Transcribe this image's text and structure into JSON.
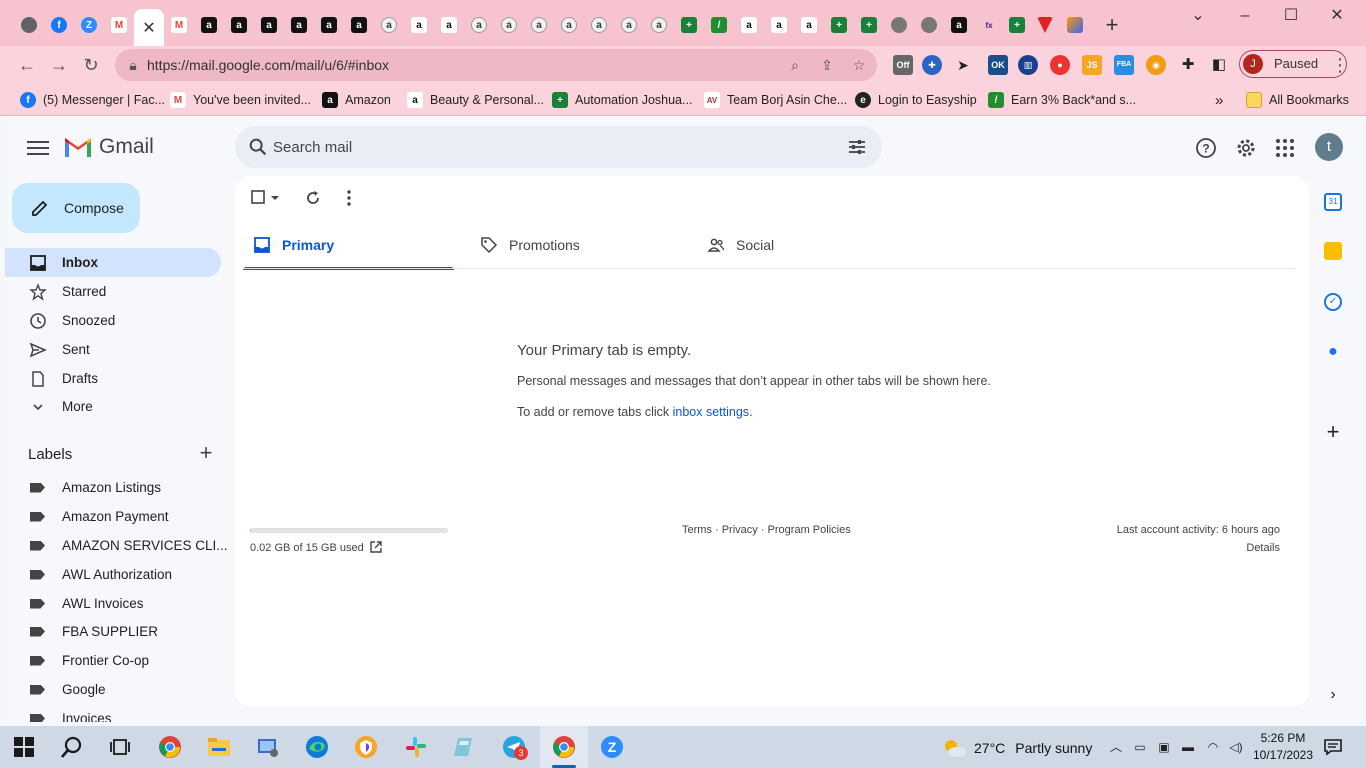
{
  "browser": {
    "url": "https://mail.google.com/mail/u/6/#inbox",
    "profile_initial": "J",
    "profile_status": "Paused",
    "bookmarks": [
      {
        "label": "(5) Messenger | Fac...",
        "icon": "facebook-icon"
      },
      {
        "label": "You've been invited...",
        "icon": "gmail-icon"
      },
      {
        "label": "Amazon",
        "icon": "amazon-icon"
      },
      {
        "label": "Beauty & Personal...",
        "icon": "amazon-smile-icon"
      },
      {
        "label": "Automation Joshua...",
        "icon": "sheets-icon"
      },
      {
        "label": "Team Borj Asin Che...",
        "icon": "team-icon"
      },
      {
        "label": "Login to Easyship",
        "icon": "easyship-icon"
      },
      {
        "label": "Earn 3% Back*and s...",
        "icon": "cashback-icon"
      }
    ],
    "all_bookmarks": "All Bookmarks",
    "overflow": "»"
  },
  "gmail": {
    "brand": "Gmail",
    "search_placeholder": "Search mail",
    "account_initial": "t",
    "compose_label": "Compose",
    "nav": [
      {
        "label": "Inbox",
        "icon": "inbox-icon",
        "active": true
      },
      {
        "label": "Starred",
        "icon": "star-icon"
      },
      {
        "label": "Snoozed",
        "icon": "clock-icon"
      },
      {
        "label": "Sent",
        "icon": "send-icon"
      },
      {
        "label": "Drafts",
        "icon": "draft-icon"
      },
      {
        "label": "More",
        "icon": "chevron-down-icon"
      }
    ],
    "labels_title": "Labels",
    "labels": [
      "Amazon Listings",
      "Amazon Payment",
      "AMAZON SERVICES CLI...",
      "AWL Authorization",
      "AWL Invoices",
      "FBA SUPPLIER",
      "Frontier Co-op",
      "Google",
      "Invoices"
    ],
    "tabs": [
      {
        "label": "Primary",
        "active": true
      },
      {
        "label": "Promotions"
      },
      {
        "label": "Social"
      }
    ],
    "empty": {
      "title": "Your Primary tab is empty.",
      "description": "Personal messages and messages that don’t appear in other tabs will be shown here.",
      "hint_prefix": "To add or remove tabs click ",
      "hint_link": "inbox settings",
      "hint_suffix": "."
    },
    "storage": {
      "text": "0.02 GB of 15 GB used",
      "used_fraction": 0.0013
    },
    "footer_links": "Terms · Privacy · Program Policies",
    "last_activity": "Last account activity: 6 hours ago",
    "details": "Details"
  },
  "taskbar": {
    "weather_temp": "27°C",
    "weather_desc": "Partly sunny",
    "time": "5:26 PM",
    "date": "10/17/2023",
    "telegram_badge": "3"
  },
  "colors": {
    "chrome_tabstrip": "#f7c3cf",
    "chrome_toolbar": "#fbd3dc",
    "gmail_accent": "#0b57d0",
    "compose_bg": "#c2e7ff",
    "inbox_active_bg": "#d3e3fd"
  }
}
